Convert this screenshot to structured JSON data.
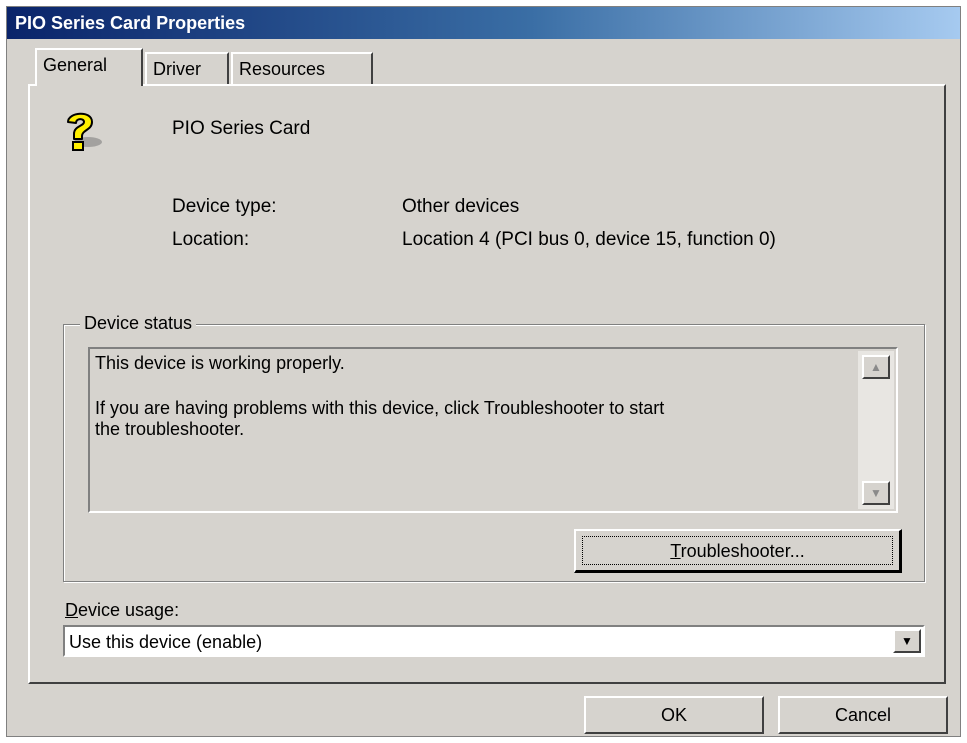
{
  "window": {
    "title": "PIO Series Card Properties"
  },
  "tabs": [
    {
      "label": "General",
      "active": true
    },
    {
      "label": "Driver",
      "active": false
    },
    {
      "label": "Resources",
      "active": false
    }
  ],
  "device": {
    "icon": "question-mark-device-icon",
    "name": "PIO Series Card",
    "type_label": "Device type:",
    "type_value": "Other devices",
    "location_label": "Location:",
    "location_value": "Location 4 (PCI bus 0, device 15, function 0)"
  },
  "status": {
    "group_label": "Device status",
    "line1": "This device is working properly.",
    "line2": "If you are having problems with this device, click Troubleshooter to start",
    "line3": "the troubleshooter.",
    "troubleshooter_button": {
      "mnemonic": "T",
      "rest": "roubleshooter..."
    }
  },
  "usage": {
    "label_mnemonic": "D",
    "label_rest": "evice usage:",
    "selected": "Use this device (enable)"
  },
  "buttons": {
    "ok": "OK",
    "cancel": "Cancel"
  },
  "colors": {
    "face": "#d6d3ce",
    "titlebar_start": "#0a246a",
    "titlebar_end": "#a6caf0",
    "icon_yellow": "#ffef00"
  }
}
